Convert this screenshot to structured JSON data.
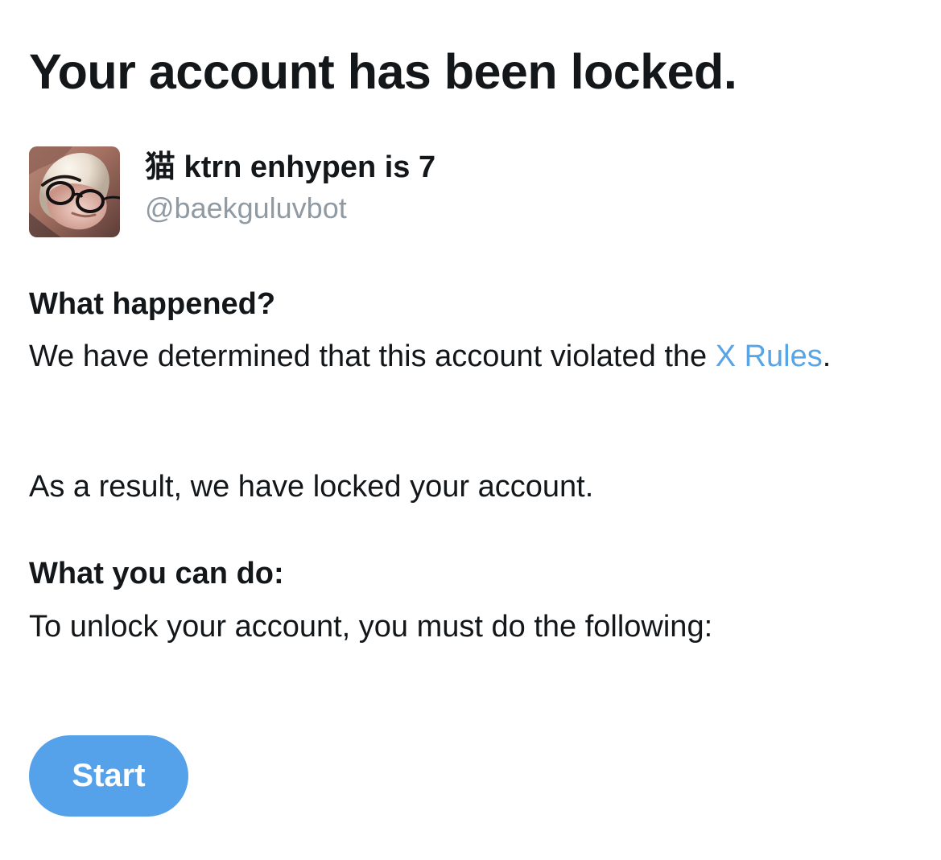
{
  "title": "Your account has been locked.",
  "account": {
    "display_name": "猫 ktrn enhypen is 7",
    "handle": "@baekguluvbot",
    "avatar_icon": "profile-photo"
  },
  "what_happened": {
    "heading": "What happened?",
    "text_before_link": "We have determined that this account violated the ",
    "link_label": "X Rules",
    "text_after_link": ".",
    "result_text": "As a result, we have locked your account."
  },
  "what_you_can_do": {
    "heading": "What you can do:",
    "text": "To unlock your account, you must do the following:"
  },
  "start_button": {
    "label": "Start"
  },
  "colors": {
    "text": "#14171a",
    "muted": "#8f9aa3",
    "link": "#57a4e7",
    "button": "#56a2ea",
    "button_text": "#ffffff"
  }
}
